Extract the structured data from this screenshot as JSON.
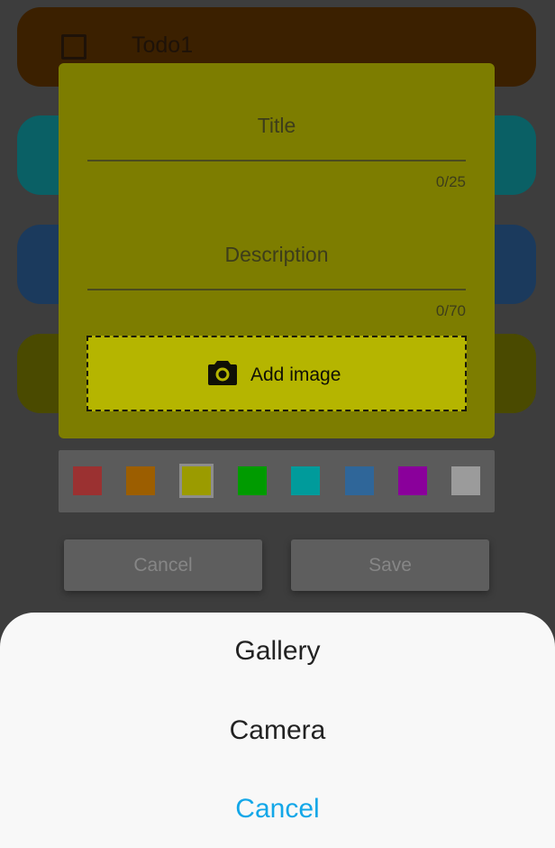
{
  "todo_list": {
    "items": [
      {
        "title": "Todo1",
        "checked": false,
        "color": "#3b2000"
      },
      {
        "title": "",
        "color": "#0a6065"
      },
      {
        "title": "",
        "color": "#1b3a5d"
      },
      {
        "title": "",
        "color": "#4a4a00"
      }
    ]
  },
  "dialog": {
    "background": "#7d7d00",
    "add_image_background": "#b5b500",
    "title_field": {
      "label": "Title",
      "value": "",
      "counter": "0/25"
    },
    "description_field": {
      "label": "Description",
      "value": "",
      "counter": "0/70"
    },
    "add_image": {
      "label": "Add image",
      "icon": "camera-icon"
    },
    "palette": {
      "selected_index": 2,
      "colors": [
        "#9b3131",
        "#9c5e00",
        "#9b9b00",
        "#009b00",
        "#009b9b",
        "#2f6699",
        "#8a009b",
        "#9b9b9b"
      ]
    },
    "buttons": {
      "cancel": "Cancel",
      "save": "Save"
    }
  },
  "bottom_sheet": {
    "gallery": "Gallery",
    "camera": "Camera",
    "cancel": "Cancel",
    "cancel_color": "#13a7e8"
  }
}
